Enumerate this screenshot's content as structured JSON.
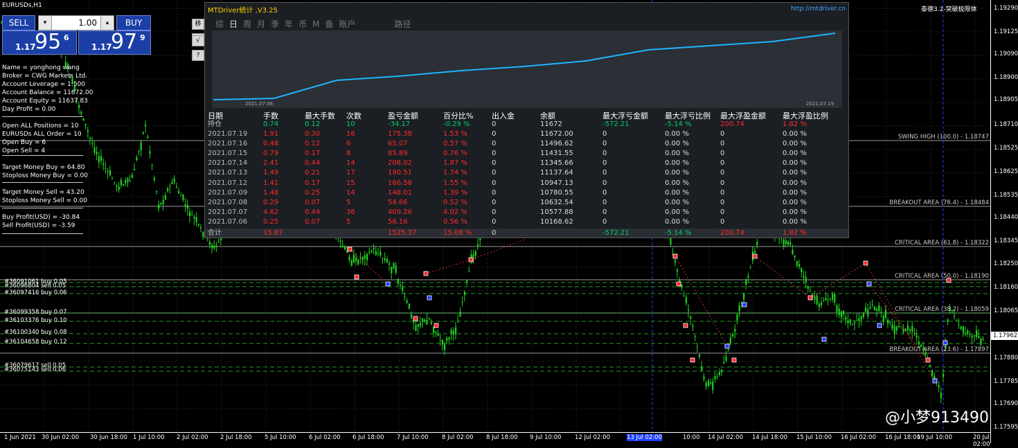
{
  "symbol_title": "EURUSDs,H1",
  "top_right_text": "泰德3.2-突破极限体",
  "trade_panel": {
    "sell_label": "SELL",
    "buy_label": "BUY",
    "lot_value": "1.00",
    "down_arrow": "▾",
    "up_arrow": "▴",
    "sell_price": {
      "prefix": "1.17",
      "big": "95",
      "sup": "6"
    },
    "buy_price": {
      "prefix": "1.17",
      "big": "97",
      "sup": "9"
    }
  },
  "account_info": [
    "Name = yonghong wang",
    "Broker = CWG Markets Ltd.",
    "Account Leverage = 1:500",
    "Account Balance = 11672.00",
    "Account Equity = 11637.83",
    "Day Profit = 0.00",
    "",
    "Open ALL Positions = 10",
    "EURUSDs ALL Order = 10",
    "Open Buy = 6",
    "Open Sell = 4",
    "",
    "Target Money Buy = 64.80",
    "Stoploss Money Buy = 0.00",
    "",
    "Target Money Sell = 43.20",
    "Stoploss Money Sell = 0.00",
    "",
    "Buy Profit(USD) = -30.84",
    "Sell Profit(USD) = -3.59"
  ],
  "side_buttons": [
    "移",
    "",
    "√",
    "?"
  ],
  "window": {
    "title": "MTDriver统计 ,V3.25",
    "url": "http://mtdriver.cn",
    "tabs": [
      "综",
      "日",
      "周",
      "月",
      "季",
      "年",
      "币",
      "M",
      "备",
      "账户",
      "路径"
    ],
    "graph_start": "2021.07.06",
    "graph_end": "2021.07.19",
    "headers": [
      "日期",
      "手数",
      "最大手数",
      "次数",
      "盈亏金额",
      "百分比%",
      "出入金",
      "余额",
      "最大浮亏金额",
      "最大浮亏比例",
      "最大浮盈金额",
      "最大浮盈比例"
    ],
    "hold_row": [
      "持仓",
      "0.74",
      "0.12",
      "10",
      "-34.17",
      "-0.29 %",
      "0",
      "11672",
      "-572.21",
      "-5.14 %",
      "200.74",
      "1.82 %"
    ],
    "rows": [
      [
        "2021.07.19",
        "1.91",
        "0.30",
        "16",
        "175.38",
        "1.53 %",
        "0",
        "11672.00",
        "0",
        "0.00 %",
        "0",
        "0.00 %"
      ],
      [
        "2021.07.16",
        "0.48",
        "0.12",
        "6",
        "65.07",
        "0.57 %",
        "0",
        "11496.62",
        "0",
        "0.00 %",
        "0",
        "0.00 %"
      ],
      [
        "2021.07.15",
        "0.79",
        "0.17",
        "8",
        "85.89",
        "0.76 %",
        "0",
        "11431.55",
        "0",
        "0.00 %",
        "0",
        "0.00 %"
      ],
      [
        "2021.07.14",
        "2.41",
        "0.44",
        "14",
        "208.02",
        "1.87 %",
        "0",
        "11345.66",
        "0",
        "0.00 %",
        "0",
        "0.00 %"
      ],
      [
        "2021.07.13",
        "1.49",
        "0.21",
        "17",
        "190.51",
        "1.74 %",
        "0",
        "11137.64",
        "0",
        "0.00 %",
        "0",
        "0.00 %"
      ],
      [
        "2021.07.12",
        "1.41",
        "0.17",
        "15",
        "166.58",
        "1.55 %",
        "0",
        "10947.13",
        "0",
        "0.00 %",
        "0",
        "0.00 %"
      ],
      [
        "2021.07.09",
        "1.48",
        "0.25",
        "14",
        "148.01",
        "1.39 %",
        "0",
        "10780.55",
        "0",
        "0.00 %",
        "0",
        "0.00 %"
      ],
      [
        "2021.07.08",
        "0.29",
        "0.07",
        "5",
        "54.66",
        "0.52 %",
        "0",
        "10632.54",
        "0",
        "0.00 %",
        "0",
        "0.00 %"
      ],
      [
        "2021.07.07",
        "4.62",
        "0.44",
        "36",
        "409.26",
        "4.02 %",
        "0",
        "10577.88",
        "0",
        "0.00 %",
        "0",
        "0.00 %"
      ],
      [
        "2021.07.06",
        "0.25",
        "0.07",
        "5",
        "56.16",
        "0.56 %",
        "0",
        "10168.62",
        "0",
        "0.00 %",
        "0",
        "0.00 %"
      ]
    ],
    "sum_row": [
      "合计",
      "15.87",
      "",
      "",
      "1525.37",
      "15.08 %",
      "0",
      "",
      "-572.21",
      "-5.14 %",
      "200.74",
      "1.82 %"
    ]
  },
  "price_axis": [
    "1.19290",
    "1.19125",
    "1.19090",
    "1.18900",
    "1.18905",
    "1.18710",
    "1.18525",
    "1.18625",
    "1.18535",
    "1.18440",
    "1.18345",
    "1.18250",
    "1.18160",
    "1.18065",
    "1.17962",
    "1.17880",
    "1.17785",
    "1.17690",
    "1.17595"
  ],
  "current_price": "1.17962",
  "time_axis": [
    "1 Jun 2021",
    "30 Jun 02:00",
    "30 Jun 18:00",
    "1 Jul 10:00",
    "2 Jul 02:00",
    "2 Jul 18:00",
    "5 Jul 10:00",
    "6 Jul 02:00",
    "6 Jul 18:00",
    "7 Jul 10:00",
    "8 Jul 02:00",
    "8 Jul 18:00",
    "9 Jul 10:00",
    "12 Jul 02:00",
    "13 Jul 02:00",
    "10:00",
    "14 Jul 02:00",
    "14 Jul 18:00",
    "15 Jul 10:00",
    "16 Jul 02:00",
    "16 Jul 18:00",
    "19 Jul 10:00",
    "20 Jul 02:00"
  ],
  "levels": [
    "SWING HIGH (100.0) - 1.18747",
    "BREAKOUT AREA (76.4) - 1.18484",
    "CRITICAL AREA (61.8) - 1.18322",
    "CRITICAL AREA (50.0) - 1.18190",
    "CRITICAL AREA (38.2) - 1.18059",
    "BREAKOUT AREA (23.6) - 1.17897"
  ],
  "orders": [
    "#36091061 buy 0.05",
    "#36096804 sell 0.05",
    "#36097416 buy 0.06",
    "#36099358 buy 0.07",
    "#36103376 buy 0.10",
    "#36100340 buy 0.08",
    "#36104658 buy 0.12",
    "#36079617 sell 0.05",
    "#36075143 sell 0.06"
  ],
  "watermark": "@小梦913490",
  "colors": {
    "candle": "#21d321",
    "accent_cyan": "#1fb6ff",
    "title_yellow": "#ffd200",
    "green_text": "#00d26a",
    "red_text": "#ff2b2b",
    "grid": "#2f3a2f",
    "vline": "#1f3fff"
  }
}
